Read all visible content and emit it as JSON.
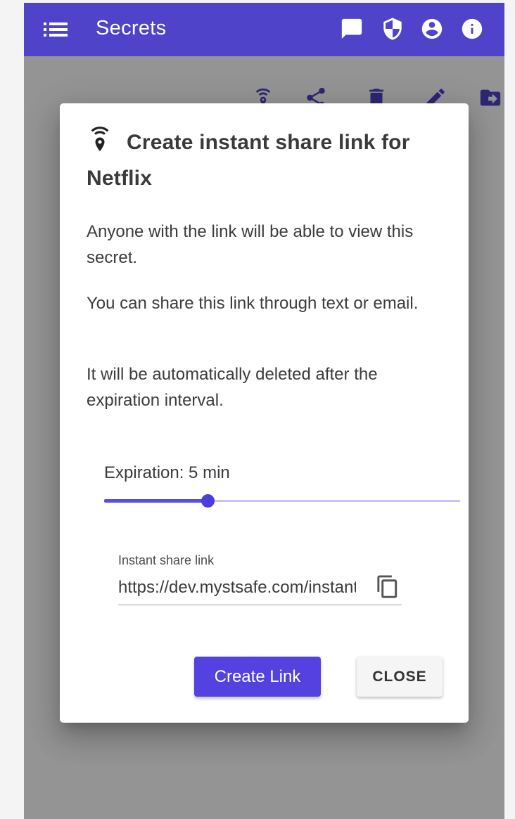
{
  "appbar": {
    "title": "Secrets",
    "icons": [
      "list-icon",
      "message-icon",
      "shield-icon",
      "account-icon",
      "info-icon"
    ],
    "background": "#4f44c9"
  },
  "toolbar_icons": [
    "instant-share-icon",
    "share-icon",
    "delete-icon",
    "edit-icon",
    "move-icon"
  ],
  "dialog": {
    "title_line1": "Create instant share link for",
    "title_line2": "Netflix",
    "paragraphs": [
      "Anyone with the link will be able to view this secret.",
      "You can share this link through text or email.",
      "It will be automatically deleted after the expiration interval."
    ],
    "expiration_label": "Expiration: 5 min",
    "expiration_slider_fraction": 0.29,
    "link_field": {
      "label": "Instant share link",
      "value": "https://dev.mystsafe.com/instant-share"
    },
    "create_button": "Create Link",
    "close_button": "CLOSE",
    "accent_color": "#5341e0"
  }
}
